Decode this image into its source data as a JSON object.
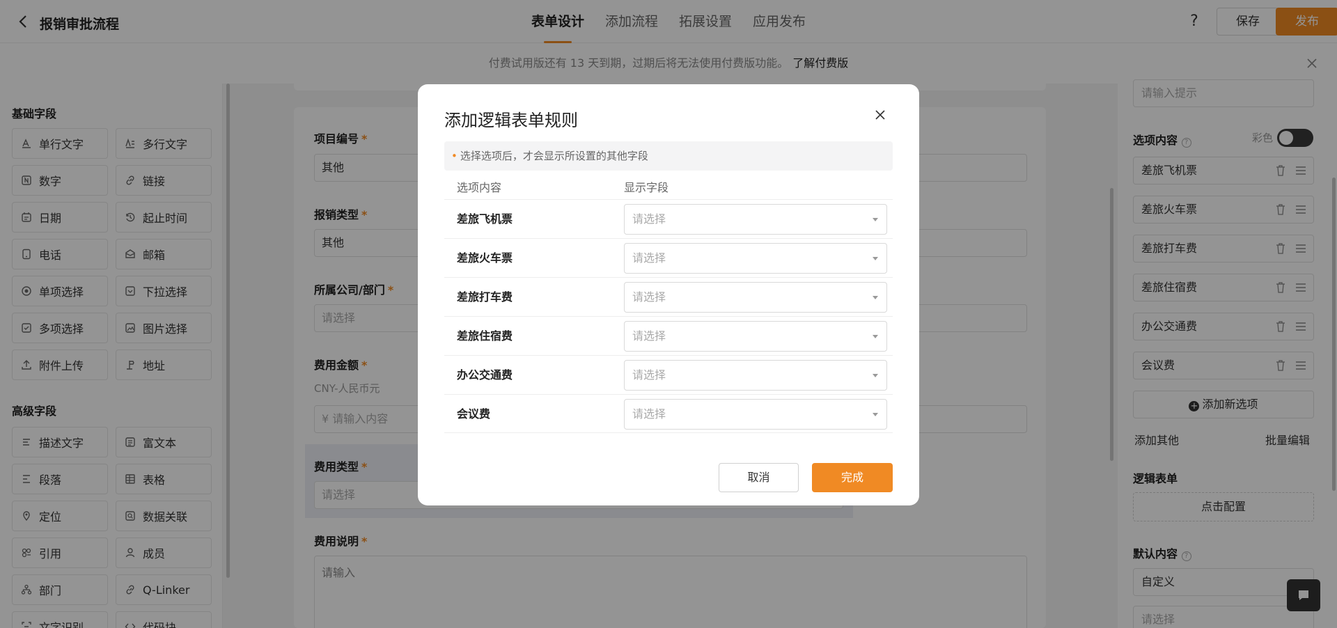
{
  "header": {
    "title": "报销审批流程",
    "tabs": [
      {
        "label": "表单设计",
        "active": true
      },
      {
        "label": "添加流程",
        "active": false
      },
      {
        "label": "拓展设置",
        "active": false
      },
      {
        "label": "应用发布",
        "active": false
      }
    ],
    "help_label": "?",
    "save_label": "保存",
    "publish_label": "发布"
  },
  "notice": {
    "text": "付费试用版还有 13 天到期，过期后将无法使用付费版功能。",
    "link": "了解付费版"
  },
  "left_panel": {
    "basic_title": "基础字段",
    "basic_fields": [
      {
        "label": "单行文字",
        "icon": "text-line-icon"
      },
      {
        "label": "多行文字",
        "icon": "text-multiline-icon"
      },
      {
        "label": "数字",
        "icon": "number-icon"
      },
      {
        "label": "链接",
        "icon": "link-icon"
      },
      {
        "label": "日期",
        "icon": "calendar-icon"
      },
      {
        "label": "起止时间",
        "icon": "time-range-icon"
      },
      {
        "label": "电话",
        "icon": "phone-icon"
      },
      {
        "label": "邮箱",
        "icon": "mail-icon"
      },
      {
        "label": "单项选择",
        "icon": "radio-icon"
      },
      {
        "label": "下拉选择",
        "icon": "dropdown-icon"
      },
      {
        "label": "多项选择",
        "icon": "checkbox-icon"
      },
      {
        "label": "图片选择",
        "icon": "image-icon"
      },
      {
        "label": "附件上传",
        "icon": "upload-icon"
      },
      {
        "label": "地址",
        "icon": "location-icon"
      }
    ],
    "advanced_title": "高级字段",
    "advanced_fields": [
      {
        "label": "描述文字",
        "icon": "description-icon"
      },
      {
        "label": "富文本",
        "icon": "rich-text-icon"
      },
      {
        "label": "段落",
        "icon": "paragraph-icon"
      },
      {
        "label": "表格",
        "icon": "table-icon"
      },
      {
        "label": "定位",
        "icon": "position-icon"
      },
      {
        "label": "数据关联",
        "icon": "data-link-icon"
      },
      {
        "label": "引用",
        "icon": "reference-icon"
      },
      {
        "label": "成员",
        "icon": "member-icon"
      },
      {
        "label": "部门",
        "icon": "department-icon"
      },
      {
        "label": "Q-Linker",
        "icon": "q-linker-icon"
      },
      {
        "label": "文字识别",
        "icon": "ocr-icon"
      },
      {
        "label": "代码块",
        "icon": "code-icon"
      }
    ]
  },
  "form": {
    "project_no": {
      "label": "项目编号",
      "value": "其他"
    },
    "reimburse_type": {
      "label": "报销类型",
      "value": "其他"
    },
    "company_dept": {
      "label": "所属公司/部门",
      "placeholder": "请选择"
    },
    "amount": {
      "label": "费用金额",
      "currency": "CNY-人民币元",
      "placeholder": "¥ 请输入内容"
    },
    "expense_type": {
      "label": "费用类型",
      "placeholder": "请选择"
    },
    "description": {
      "label": "费用说明",
      "placeholder": "请输入"
    }
  },
  "right_panel": {
    "hint_placeholder": "请输入提示",
    "options_title": "选项内容",
    "color_label": "彩色",
    "options": [
      "差旅飞机票",
      "差旅火车票",
      "差旅打车费",
      "差旅住宿费",
      "办公交通费",
      "会议费"
    ],
    "add_option": "添加新选项",
    "add_other": "添加其他",
    "batch_edit": "批量编辑",
    "logic_title": "逻辑表单",
    "logic_button": "点击配置",
    "default_title": "默认内容",
    "default_value": "自定义",
    "default_placeholder": "请选择"
  },
  "modal": {
    "title": "添加逻辑表单规则",
    "tip": "选择选项后，才会显示所设置的其他字段",
    "col_option": "选项内容",
    "col_field": "显示字段",
    "rows": [
      {
        "option": "差旅飞机票",
        "placeholder": "请选择"
      },
      {
        "option": "差旅火车票",
        "placeholder": "请选择"
      },
      {
        "option": "差旅打车费",
        "placeholder": "请选择"
      },
      {
        "option": "差旅住宿费",
        "placeholder": "请选择"
      },
      {
        "option": "办公交通费",
        "placeholder": "请选择"
      },
      {
        "option": "会议费",
        "placeholder": "请选择"
      }
    ],
    "cancel_label": "取消",
    "done_label": "完成"
  },
  "colors": {
    "accent": "#f08a24",
    "overlay": "rgba(0,0,0,0.42)"
  }
}
